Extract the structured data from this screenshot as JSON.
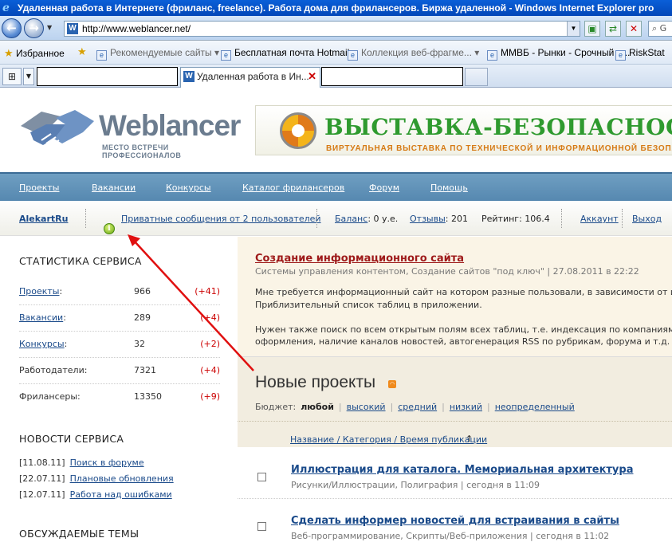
{
  "window": {
    "title": "Удаленная работа в Интернете (фриланс, freelance). Работа дома для фрилансеров. Биржа удаленной - Windows Internet Explorer pro"
  },
  "address_bar": {
    "url": "http://www.weblancer.net/",
    "search_placeholder": "G"
  },
  "favorites_bar": {
    "favorites_label": "Избранное",
    "items": [
      "Рекомендуемые сайты",
      "Бесплатная почта Hotmail",
      "Коллекция веб-фрагме...",
      "ММВБ - Рынки - Срочный р...",
      "RiskStat"
    ]
  },
  "tabs": {
    "active_title": "Удаленная работа в Ин..."
  },
  "site": {
    "logo_word": "Weblancer",
    "logo_slogan": "МЕСТО ВСТРЕЧИ ПРОФЕССИОНАЛОВ",
    "banner_title": "ВЫСТАВКА-БЕЗОПАСНОСТИ",
    "banner_subtitle": "ВИРТУАЛЬНАЯ ВЫСТАВКА ПО ТЕХНИЧЕСКОЙ И ИНФОРМАЦИОННОЙ БЕЗОПАС",
    "nav": [
      "Проекты",
      "Вакансии",
      "Конкурсы",
      "Каталог фрилансеров",
      "Форум",
      "Помощь"
    ]
  },
  "userbar": {
    "username": "AlekartRu",
    "messages": "Приватные сообщения от 2 пользователей",
    "balance_label": "Баланс",
    "balance_value": ": 0 у.е.",
    "reviews_label": "Отзывы",
    "reviews_value": ": 201",
    "rating": "Рейтинг: 106.4",
    "account": "Аккаунт",
    "logout": "Выход"
  },
  "sidebar": {
    "stats_title": "СТАТИСТИКА СЕРВИСА",
    "stats": [
      {
        "label": "Проекты",
        "suffix": ":",
        "value": "966",
        "delta": "(+41)"
      },
      {
        "label": "Вакансии",
        "suffix": ":",
        "value": "289",
        "delta": "(+4)"
      },
      {
        "label": "Конкурсы",
        "suffix": ":",
        "value": "32",
        "delta": "(+2)"
      },
      {
        "label": "Работодатели:",
        "suffix": "",
        "value": "7321",
        "delta": "(+4)"
      },
      {
        "label": "Фрилансеры:",
        "suffix": "",
        "value": "13350",
        "delta": "(+9)"
      }
    ],
    "news_title": "НОВОСТИ СЕРВИСА",
    "news": [
      {
        "date": "[11.08.11]",
        "text": "Поиск в форуме"
      },
      {
        "date": "[22.07.11]",
        "text": "Плановые обновления"
      },
      {
        "date": "[12.07.11]",
        "text": "Работа над ошибками"
      }
    ],
    "topics_title": "ОБСУЖДАЕМЫЕ ТЕМЫ"
  },
  "featured": {
    "title": "Создание информационного сайта",
    "meta": "Системы управления контентом, Создание сайтов \"под ключ\" | 27.08.2011 в 22:22",
    "lines": [
      "Мне требуется информационный сайт на котором разные пользовали, в зависимости от их ролей, м",
      "Приблизительный список таблиц в приложении.",
      "",
      "Нужен также поиск по всем открытым полям всех таблиц, т.е. индексация по компаниям, оборудо",
      "оформления, наличие каналов новостей, автогенерация RSS по рубрикам, форума и т.д. В итого соде"
    ]
  },
  "projects": {
    "heading": "Новые проекты",
    "budget_label": "Бюджет:",
    "budget_selected": "любой",
    "budget_options": [
      "высокий",
      "средний",
      "низкий",
      "неопределенный"
    ],
    "sort_label": "Название / Категория / Время публикации",
    "sort_arrow": "↑",
    "items": [
      {
        "title": "Иллюстрация для каталога. Мемориальная архитектура",
        "meta": "Рисунки/Иллюстрации, Полиграфия | сегодня в 11:09"
      },
      {
        "title": "Сделать информер новостей для встраивания в сайты",
        "meta": "Веб-программирование, Скрипты/Веб-приложения | сегодня в 11:02"
      }
    ]
  },
  "colors": {
    "nav_bg": "#5f93b9",
    "featured_bg": "#faf4e6",
    "link": "#1a4a8a",
    "accent_red": "#c00000",
    "annotation_arrow": "#e01010"
  }
}
